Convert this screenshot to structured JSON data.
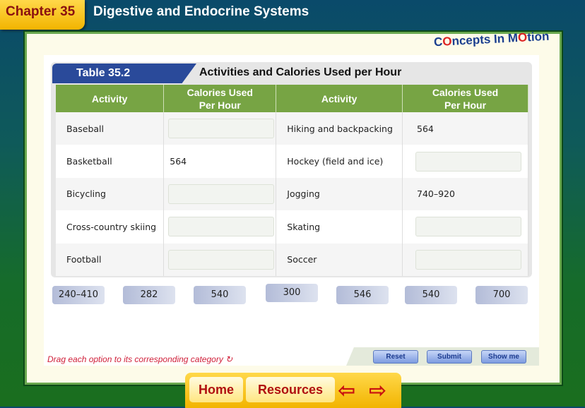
{
  "header": {
    "chapter": "Chapter 35",
    "title": "Digestive and Endocrine Systems"
  },
  "logo": {
    "text_a": "C",
    "text_o": "O",
    "text_b": "ncepts In M",
    "text_o2": "O",
    "text_c": "tion",
    "full": "Concepts In Motion"
  },
  "table": {
    "label": "Table 35.2",
    "title": "Activities and Calories Used per Hour",
    "headers": [
      "Activity",
      "Calories Used Per Hour",
      "Activity",
      "Calories Used Per Hour"
    ],
    "rows": [
      {
        "left": "Baseball",
        "left_value": "",
        "right": "Hiking and backpacking",
        "right_value": "564"
      },
      {
        "left": "Basketball",
        "left_value": "564",
        "right": "Hockey (field and ice)",
        "right_value": ""
      },
      {
        "left": "Bicycling",
        "left_value": "",
        "right": "Jogging",
        "right_value": "740–920"
      },
      {
        "left": "Cross-country skiing",
        "left_value": "",
        "right": "Skating",
        "right_value": ""
      },
      {
        "left": "Football",
        "left_value": "",
        "right": "Soccer",
        "right_value": ""
      }
    ]
  },
  "options": [
    "240–410",
    "282",
    "540",
    "300",
    "546",
    "540",
    "700"
  ],
  "instruction": "Drag each option to its corresponding category",
  "buttons": {
    "reset": "Reset",
    "submit": "Submit",
    "show_me": "Show me"
  },
  "nav": {
    "home": "Home",
    "resources": "Resources"
  },
  "colors": {
    "header_green": "#77a444",
    "tab_blue": "#2a4a9a",
    "chapter_yellow": "#f2b400",
    "instruction_red": "#d0203a"
  }
}
